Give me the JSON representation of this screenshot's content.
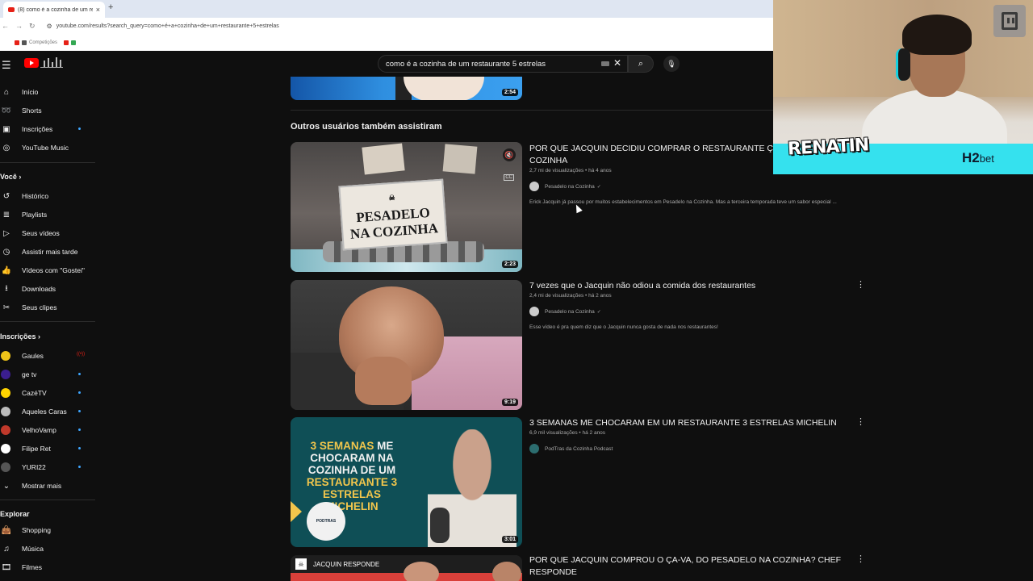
{
  "browser": {
    "tab_title": "(8) como é a cozinha de um res",
    "tab_close": "×",
    "new_tab": "+",
    "url": "youtube.com/results?search_query=como+é+a+cozinha+de+um+restaurante+5+estrelas",
    "bookmark_label": "Competições"
  },
  "masthead": {
    "search_value": "como é a cozinha de um restaurante 5 estrelas"
  },
  "sidebar": {
    "main": [
      {
        "label": "Início"
      },
      {
        "label": "Shorts"
      },
      {
        "label": "Inscrições"
      },
      {
        "label": "YouTube Music"
      }
    ],
    "voce_header": "Você",
    "voce": [
      {
        "label": "Histórico"
      },
      {
        "label": "Playlists"
      },
      {
        "label": "Seus vídeos"
      },
      {
        "label": "Assistir mais tarde"
      },
      {
        "label": "Vídeos com \"Gostei\""
      },
      {
        "label": "Downloads"
      },
      {
        "label": "Seus clipes"
      }
    ],
    "subs_header": "Inscrições",
    "subs": [
      {
        "label": "Gaules"
      },
      {
        "label": "ge tv"
      },
      {
        "label": "CazéTV"
      },
      {
        "label": "Aqueles Caras"
      },
      {
        "label": "VelhoVamp"
      },
      {
        "label": "Filipe Ret"
      },
      {
        "label": "YURI22"
      }
    ],
    "show_more": "Mostrar mais",
    "explore_header": "Explorar",
    "explore": [
      {
        "label": "Shopping"
      },
      {
        "label": "Música"
      },
      {
        "label": "Filmes"
      }
    ]
  },
  "main": {
    "top_duration": "2:54",
    "section_title": "Outros usuários também assistiram",
    "videos": [
      {
        "title_line1": "POR QUE JACQUIN DECIDIU COMPRAR O RESTAURANTE ÇA-VA? PESADELO NA",
        "title_line2": "COZINHA",
        "meta": "2,7 mi de visualizações • há 4 anos",
        "channel": "Pesadelo na Cozinha",
        "desc": "Erick Jacquin já passou por muitos estabelecimentos em Pesadelo na Cozinha. Mas a terceira temporada teve um sabor especial ...",
        "duration": "2:23",
        "thumb_text_1": "PESADELO",
        "thumb_text_2": "NA COZINHA"
      },
      {
        "title_line1": "7 vezes que o Jacquin não odiou a comida dos restaurantes",
        "meta": "2,4 mi de visualizações • há 2 anos",
        "channel": "Pesadelo na Cozinha",
        "desc": "Esse vídeo é pra quem diz que o Jacquin nunca gosta de nada nos restaurantes!",
        "duration": "9:19"
      },
      {
        "title_line1": "3 SEMANAS ME CHOCARAM EM UM RESTAURANTE 3 ESTRELAS MICHELIN",
        "meta": "6,9 mil visualizações • há 2 anos",
        "channel": "PodTras da Cozinha Podcast",
        "duration": "3:01",
        "thumb_a": "3 SEMANAS",
        "thumb_b": " ME CHOCARAM NA COZINHA DE UM ",
        "thumb_c": "RESTAURANTE 3 ESTRELAS MICHELIN",
        "thumb_logo": "PODTRAS"
      },
      {
        "title_line1": "POR QUE JACQUIN COMPROU O ÇA-VA, DO PESADELO NA COZINHA? CHEF",
        "title_line2": "RESPONDE",
        "thumb_label": "JACQUIN RESPONDE"
      }
    ]
  },
  "overlay": {
    "streamer": "RENATIN",
    "sponsor_main": "H2",
    "sponsor_sub": "bet"
  },
  "icons": {
    "verified": "✓",
    "kebab": "⋮"
  },
  "colors": {
    "youtube_red": "#ff0000",
    "accent_blue": "#3ea6ff",
    "overlay_cyan": "#35e1ee"
  }
}
